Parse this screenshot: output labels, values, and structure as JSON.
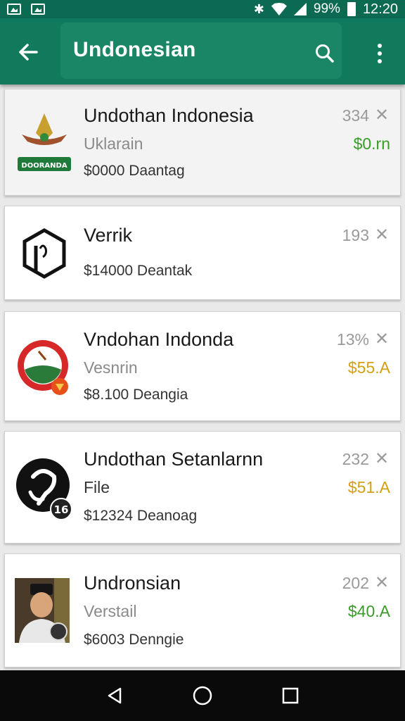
{
  "status_bar": {
    "battery": "99%",
    "time": "12:20",
    "icons": [
      "image-icon",
      "gallery-icon",
      "bluetooth-icon",
      "wifi-icon",
      "signal-icon",
      "battery-icon"
    ]
  },
  "app_bar": {
    "title": "Undonesian",
    "icons": [
      "back-arrow-icon",
      "search-icon",
      "more-vert-icon"
    ]
  },
  "cards": [
    {
      "name": "Undothan Indonesia",
      "sub": "Uklarain",
      "price_line": "$0000 Daantag",
      "count": "334",
      "price": "$0.rn",
      "price_color": "#3a9a2a",
      "icon": "emblem-icon",
      "icon_text": "DOORANDA"
    },
    {
      "name": "Verrik",
      "sub": "",
      "price_line": "$14000 Deantak",
      "count": "193",
      "price": "",
      "price_color": "#3a9a2a",
      "icon": "hexagon-logo-icon"
    },
    {
      "name": "Vndohan Indonda",
      "sub": "Vesnrin",
      "price_line": "$8.100 Deangia",
      "count": "13%",
      "price": "$55.A",
      "price_color": "#d4a017",
      "icon": "red-circle-emblem-icon"
    },
    {
      "name": "Undothan Setanlarnn",
      "sub": "File",
      "price_line": "$12324 Deanoag",
      "count": "232",
      "price": "$51.A",
      "price_color": "#d4a017",
      "icon": "black-circle-logo-icon",
      "icon_text": "16"
    },
    {
      "name": "Undronsian",
      "sub": "Verstail",
      "price_line": "$6003 Denngie",
      "count": "202",
      "price": "$40.A",
      "price_color": "#3a9a2a",
      "icon": "portrait-photo-icon"
    }
  ],
  "nav_bar": {
    "icons": [
      "back-triangle-icon",
      "home-circle-icon",
      "recents-square-icon"
    ]
  }
}
